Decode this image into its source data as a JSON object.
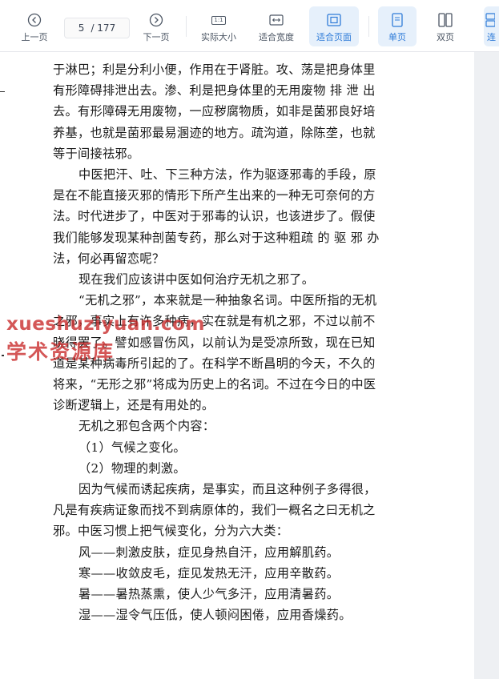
{
  "toolbar": {
    "prev_label": "上一页",
    "current_page": "5",
    "total_pages": "/ 177",
    "next_label": "下一页",
    "actual_size_label": "实际大小",
    "actual_size_icon_text": "1:1",
    "fit_width_label": "适合宽度",
    "fit_page_label": "适合页面",
    "single_label": "单页",
    "double_label": "双页",
    "continuous_label": "连"
  },
  "document": {
    "lines": [
      "于淋巴；利是分利小便，作用在于肾脏。攻、荡是把身体里",
      "有形障碍排泄出去。渗、利是把身体里的无用废物 排 泄 出",
      "去。有形障碍无用废物，一应秽腐物质，如非是菌邪良好培",
      "养基，也就是菌邪最易溷迹的地方。疏沟道，除陈垄，也就",
      "等于间接祛邪。",
      "中医把汗、吐、下三种方法，作为驱逐邪毒的手段，原",
      "是在不能直接灭邪的情形下所产生出来的一种无可奈何的方",
      "法。时代进步了，中医对于邪毒的认识，也该进步了。假使",
      "我们能够发现某种剖菌专药，那么对于这种粗疏 的 驱 邪 办",
      "法，何必再留恋呢？",
      "现在我们应该讲中医如何治疗无机之邪了。",
      "“无机之邪”，本来就是一种抽象名词。中医所指的无机",
      "之邪，事实上有许多种病，实在就是有机之邪，不过以前不",
      "晓得罢了。譬如感冒伤风，以前认为是受凉所致，现在已知",
      "道是某种病毒所引起的了。在科学不断昌明的今天，不久的",
      "将来，“无形之邪”将成为历史上的名词。不过在今日的中医",
      "诊断逻辑上，还是有用处的。",
      "无机之邪包含两个内容：",
      "（1）气候之变化。",
      "（2）物理的刺激。",
      "因为气候而诱起疾病，是事实，而且这种例子多得很，",
      "凡是有疾病证象而找不到病原体的，我们一概名之曰无机之",
      "邪。中医习惯上把气候变化，分为六大类：",
      "风——刺激皮肤，症见身热自汗，应用解肌药。",
      "寒——收敛皮毛，症见发热无汗，应用辛散药。",
      "暑——暑热蒸熏，使人少气多汗，应用清暑药。",
      "湿——湿令气压低，使人顿闷困倦，应用香燥药。"
    ]
  },
  "watermark": {
    "line1": "xueshuziyuan.com",
    "line2": "学术资源库"
  },
  "colors": {
    "accent": "#2f7bd8",
    "active_bg": "#e6f0fb",
    "watermark": "#c82828"
  }
}
